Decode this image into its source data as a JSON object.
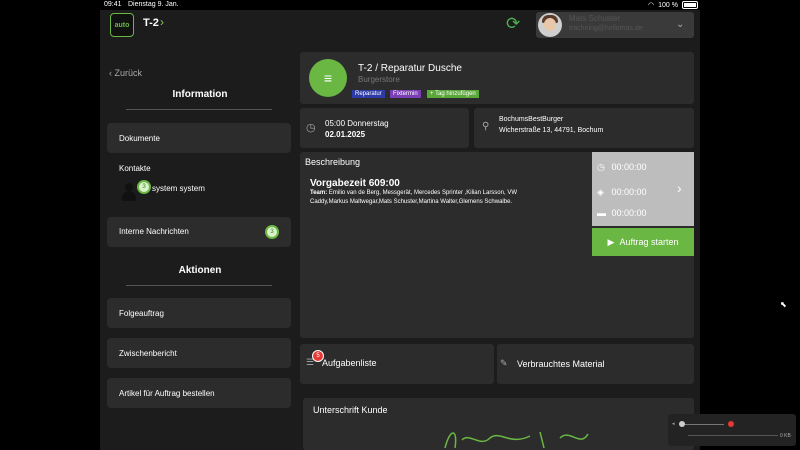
{
  "status_bar": {
    "time": "09:41",
    "date": "Dienstag 9. Jan.",
    "battery": "100 %"
  },
  "header": {
    "logo_text": "auto",
    "breadcrumb": "T-2",
    "user": {
      "name": "Mats Schuster",
      "email": "trachning@hellomas.de"
    }
  },
  "sidebar": {
    "back_label": "Zurück",
    "information_title": "Information",
    "documents_label": "Dokumente",
    "contacts_label": "Kontakte",
    "contact_badge": "3",
    "contact_name": "system system",
    "messages_label": "Interne Nachrichten",
    "messages_badge": "3",
    "actions_title": "Aktionen",
    "actions": [
      "Folgeauftrag",
      "Zwischenbericht",
      "Artikel für Auftrag bestellen"
    ]
  },
  "order": {
    "title": "T-2 / Reparatur Dusche",
    "subtitle": "Burgerstore",
    "tags": [
      {
        "label": "Reparatur",
        "color": "#2e3aa6"
      },
      {
        "label": "Fixtermin",
        "color": "#7b3fb5"
      },
      {
        "label": "+ Tag hinzufügen",
        "color": "#5aa83a"
      }
    ],
    "time": "05:00 Donnerstag",
    "date": "02.01.2025",
    "location_name": "BochumsBestBurger",
    "location_address": "Wicherstraße 13, 44791, Bochum"
  },
  "description": {
    "title": "Beschreibung",
    "heading": "Vorgabezeit 609:00",
    "team_label": "Team:",
    "team_line1": "Emilio van de Berg, Messgerät, Mercedes Sprinter ,Kilian Larsson, VW",
    "team_line2": "Caddy,Markus Maltwegar,Mats Schuster,Martina Walter,Glemens Schwalbe."
  },
  "timers": [
    "00:00:00",
    "00:00:00",
    "00:00:00"
  ],
  "start_button": "Auftrag starten",
  "tasks": {
    "label": "Aufgabenliste",
    "badge": "5"
  },
  "material": {
    "label": "Verbrauchtes Material"
  },
  "signature": {
    "title": "Unterschrift Kunde"
  },
  "player": {
    "size": "0 KB"
  },
  "colors": {
    "accent": "#6ab744",
    "panel": "#2c2c2c",
    "badge_red": "#e53935"
  }
}
